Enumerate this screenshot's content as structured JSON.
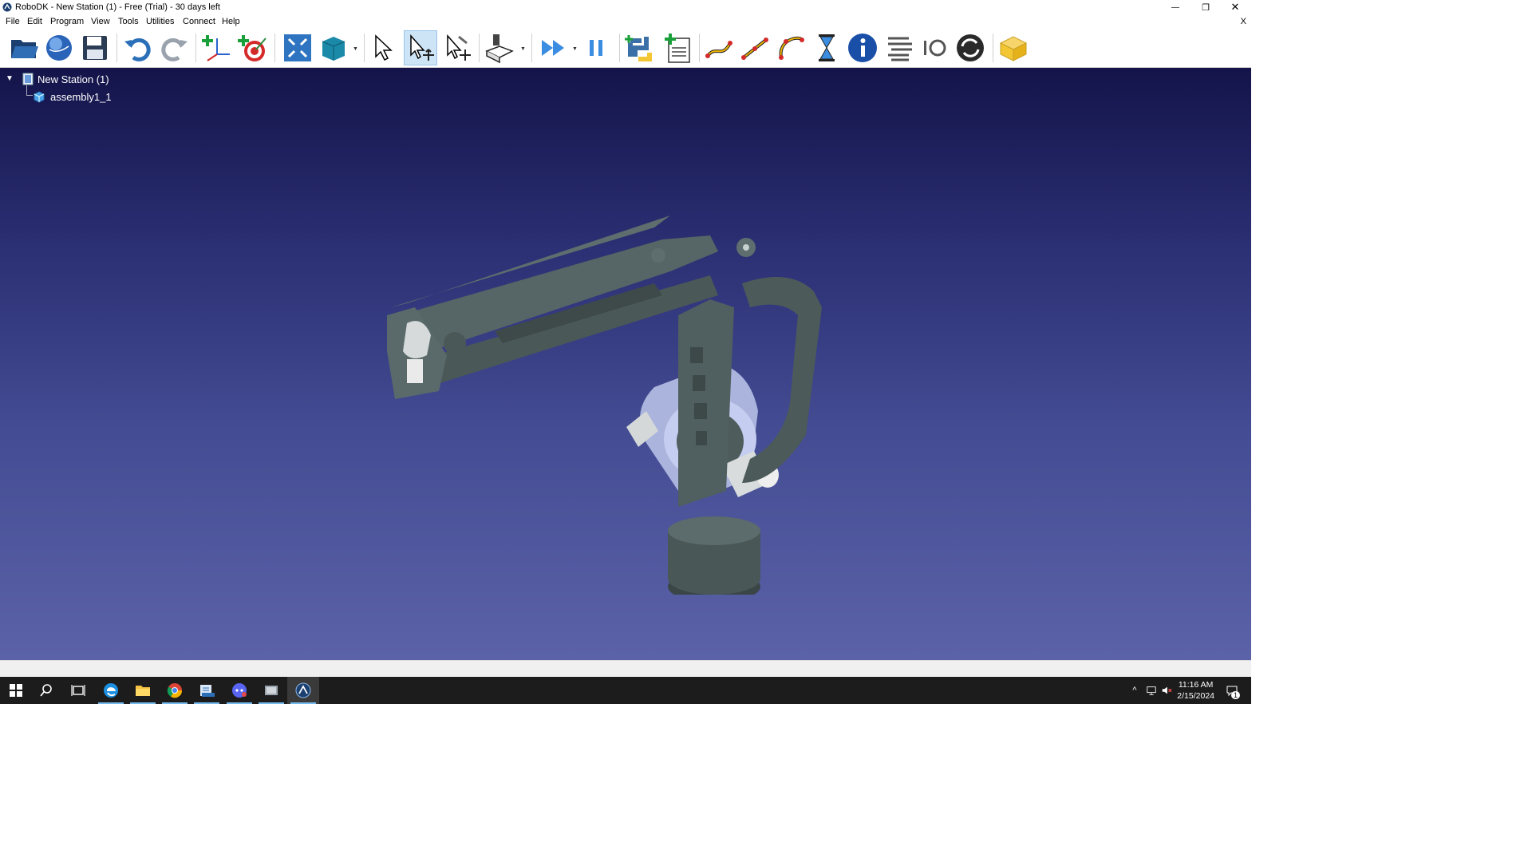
{
  "window": {
    "title": "RoboDK - New Station (1) - Free (Trial) - 30 days left",
    "controls": {
      "minimize": "—",
      "restore": "❐",
      "close": "✕"
    }
  },
  "menu": {
    "items": [
      "File",
      "Edit",
      "Program",
      "View",
      "Tools",
      "Utilities",
      "Connect",
      "Help"
    ],
    "close_label": "X"
  },
  "toolbar": {
    "buttons": [
      "open-icon",
      "online-library-icon",
      "save-icon",
      "undo-icon",
      "redo-icon",
      "add-reference-frame-icon",
      "add-target-icon",
      "fit-all-icon",
      "view-cube-icon",
      "select-icon",
      "move-reference-icon",
      "move-tool-icon",
      "add-tool-icon",
      "run-program-icon",
      "pause-icon",
      "python-program-icon",
      "add-program-icon",
      "move-joint-icon",
      "move-linear-icon",
      "move-circular-icon",
      "pause-timer-icon",
      "show-message-icon",
      "program-call-icon",
      "set-io-icon",
      "synchronize-icon",
      "export-simulation-icon"
    ],
    "active": "move-reference-icon"
  },
  "tree": {
    "station": "New Station (1)",
    "child": "assembly1_1"
  },
  "colors": {
    "viewport_top": "#14144a",
    "viewport_bottom": "#5b62a8",
    "robot_body": "#4f5f5f",
    "robot_accent": "#a9b6e6"
  },
  "taskbar": {
    "apps": [
      "windows-start-icon",
      "search-icon",
      "task-view-icon",
      "edge-icon",
      "file-explorer-icon",
      "chrome-icon",
      "app-icon",
      "discord-icon",
      "app-icon-2",
      "robodk-icon"
    ],
    "time": "11:16 AM",
    "date": "2/15/2024",
    "notifications": "1"
  }
}
